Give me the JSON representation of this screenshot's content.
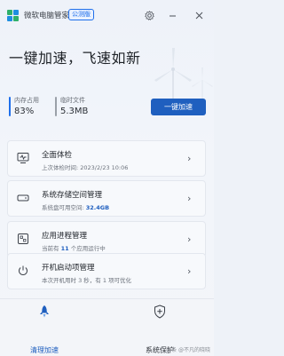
{
  "app": {
    "title": "微软电脑管家",
    "badge": "公测版"
  },
  "hero": {
    "title": "一键加速，飞速如新",
    "stats": [
      {
        "label": "内存占用",
        "value": "83%",
        "color": "#1f6feb"
      },
      {
        "label": "临时文件",
        "value": "5.3MB",
        "color": "#9aa0a8"
      }
    ],
    "accelerate_label": "一键加速"
  },
  "cards": [
    {
      "title": "全面体检",
      "sub_prefix": "上次体检时间: 2023/2/23 10:06",
      "sub_value": "",
      "sub_suffix": "",
      "icon": "monitor-check-icon"
    },
    {
      "title": "系统存储空间管理",
      "sub_prefix": "系统盘可用空间: ",
      "sub_value": "32.4GB",
      "sub_suffix": "",
      "icon": "drive-icon"
    },
    {
      "title": "应用进程管理",
      "sub_prefix": "当前有 ",
      "sub_value": "11",
      "sub_suffix": " 个应用运行中",
      "icon": "apps-icon"
    },
    {
      "title": "开机启动项管理",
      "sub_prefix": "本次开机用时 3 秒，有 1 项可优化",
      "sub_value": "",
      "sub_suffix": "",
      "icon": "power-icon"
    }
  ],
  "nav": {
    "clean_label": "清理加速",
    "protect_label": "系统保护"
  },
  "watermark": "头条 @不凡的晓晓"
}
